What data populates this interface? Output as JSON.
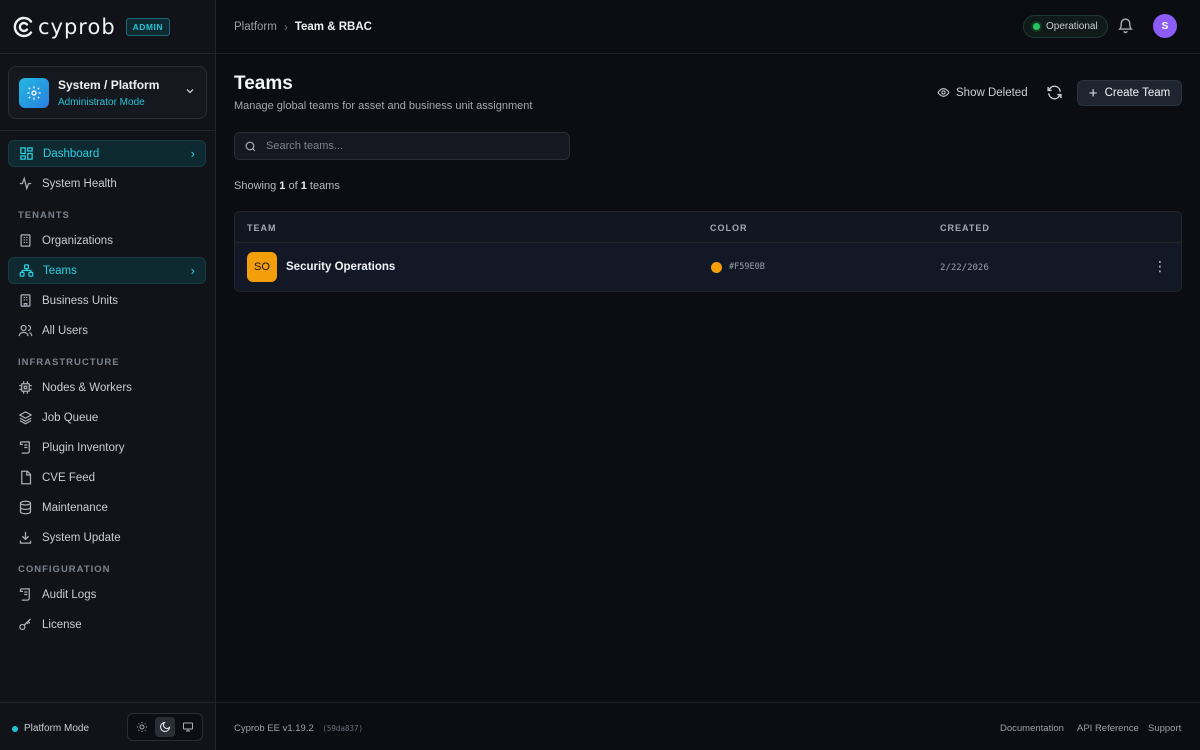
{
  "app": {
    "brand_name": "cyprob",
    "admin_badge": "ADMIN"
  },
  "org_switcher": {
    "title": "System / Platform",
    "subtitle": "Administrator Mode"
  },
  "sidebar": {
    "items": [
      {
        "label": "Dashboard",
        "icon": "dashboard-icon"
      },
      {
        "label": "System Health",
        "icon": "activity-icon"
      }
    ],
    "tenants_heading": "TENANTS",
    "tenants": [
      {
        "label": "Organizations",
        "icon": "building-icon"
      },
      {
        "label": "Teams",
        "icon": "network-icon"
      },
      {
        "label": "Business Units",
        "icon": "building-icon"
      },
      {
        "label": "All Users",
        "icon": "users-icon"
      }
    ],
    "infrastructure_heading": "INFRASTRUCTURE",
    "infrastructure": [
      {
        "label": "Nodes & Workers",
        "icon": "cpu-icon"
      },
      {
        "label": "Job Queue",
        "icon": "layers-icon"
      },
      {
        "label": "Plugin Inventory",
        "icon": "scroll-icon"
      },
      {
        "label": "CVE Feed",
        "icon": "file-icon"
      },
      {
        "label": "Maintenance",
        "icon": "database-icon"
      },
      {
        "label": "System Update",
        "icon": "download-icon"
      }
    ],
    "configuration_heading": "CONFIGURATION",
    "configuration": [
      {
        "label": "Audit Logs",
        "icon": "scroll-icon"
      },
      {
        "label": "License",
        "icon": "key-icon"
      }
    ],
    "footer": {
      "mode_label": "Platform Mode"
    }
  },
  "header": {
    "breadcrumb": {
      "parent": "Platform",
      "current": "Team & RBAC"
    },
    "status": "Operational",
    "avatar_initial": "S"
  },
  "page": {
    "title": "Teams",
    "subtitle": "Manage global teams for asset and business unit assignment",
    "show_deleted_label": "Show Deleted",
    "create_label": "Create Team",
    "search_placeholder": "Search teams...",
    "showing": {
      "prefix": "Showing",
      "count": "1",
      "of": "of",
      "total": "1",
      "suffix": "teams"
    }
  },
  "table": {
    "columns": [
      "TEAM",
      "COLOR",
      "CREATED"
    ],
    "rows": [
      {
        "initials": "SO",
        "name": "Security Operations",
        "color": "#F59E0B",
        "color_label": "#F59E0B",
        "created": "2/22/2026"
      }
    ]
  },
  "footer": {
    "version": "Cyprob EE v1.19.2",
    "hash": "(59da837)",
    "links": [
      "Documentation",
      "API Reference",
      "Support"
    ]
  },
  "colors": {
    "accent": "#22C3D8",
    "status_ok": "#22C55E",
    "avatar": "#8B5CF6"
  }
}
